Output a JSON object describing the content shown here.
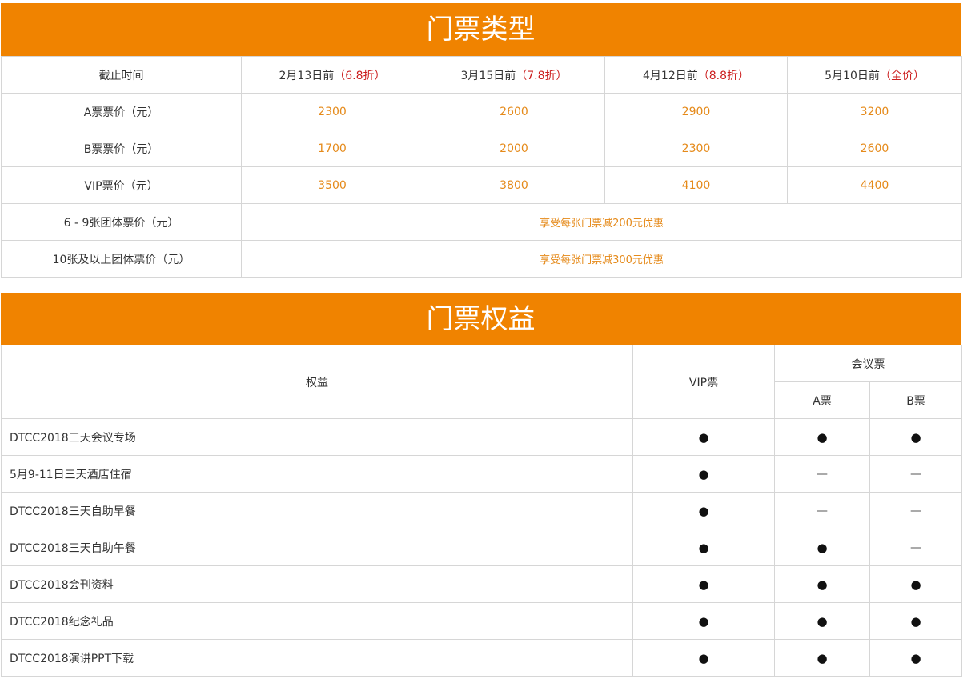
{
  "section1": {
    "title": "门票类型",
    "header": {
      "label": "截止时间",
      "cols": [
        {
          "date": "2月13日前",
          "discount": "（6.8折）"
        },
        {
          "date": "3月15日前",
          "discount": "（7.8折）"
        },
        {
          "date": "4月12日前",
          "discount": "（8.8折）"
        },
        {
          "date": "5月10日前",
          "discount": "（全价）"
        }
      ]
    },
    "rows": [
      {
        "label": "A票票价（元）",
        "values": [
          "2300",
          "2600",
          "2900",
          "3200"
        ]
      },
      {
        "label": "B票票价（元）",
        "values": [
          "1700",
          "2000",
          "2300",
          "2600"
        ]
      },
      {
        "label": "VIP票价（元）",
        "values": [
          "3500",
          "3800",
          "4100",
          "4400"
        ]
      }
    ],
    "group_rows": [
      {
        "label": "6 - 9张团体票价（元）",
        "note": "享受每张门票减200元优惠"
      },
      {
        "label": "10张及以上团体票价（元）",
        "note": "享受每张门票减300元优惠"
      }
    ]
  },
  "section2": {
    "title": "门票权益",
    "header": {
      "benefit": "权益",
      "vip": "VIP票",
      "meeting": "会议票",
      "a": "A票",
      "b": "B票"
    },
    "symbols": {
      "yes": "●",
      "no": "—"
    },
    "rows": [
      {
        "label": "DTCC2018三天会议专场",
        "vip": "●",
        "a": "●",
        "b": "●"
      },
      {
        "label": "5月9-11日三天酒店住宿",
        "vip": "●",
        "a": "—",
        "b": "—"
      },
      {
        "label": "DTCC2018三天自助早餐",
        "vip": "●",
        "a": "—",
        "b": "—"
      },
      {
        "label": "DTCC2018三天自助午餐",
        "vip": "●",
        "a": "●",
        "b": "—"
      },
      {
        "label": "DTCC2018会刊资料",
        "vip": "●",
        "a": "●",
        "b": "●"
      },
      {
        "label": "DTCC2018纪念礼品",
        "vip": "●",
        "a": "●",
        "b": "●"
      },
      {
        "label": "DTCC2018演讲PPT下载",
        "vip": "●",
        "a": "●",
        "b": "●"
      }
    ]
  },
  "colors": {
    "accent": "#f08300",
    "price": "#e58a1a",
    "discount": "#cc1f1f",
    "border": "#d6d6d6"
  }
}
